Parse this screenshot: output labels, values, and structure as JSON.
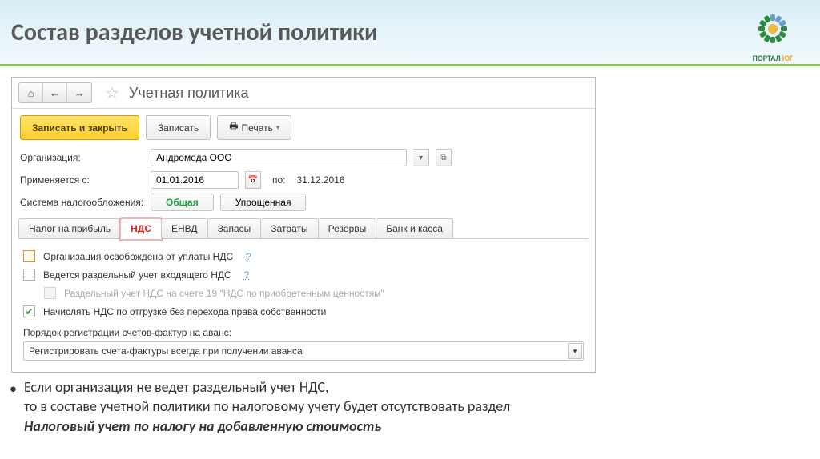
{
  "slide": {
    "title": "Состав разделов учетной политики",
    "logo": {
      "line1": "ПОРТАЛ",
      "line2": "ЮГ"
    }
  },
  "form": {
    "title": "Учетная политика",
    "toolbar": {
      "save_close": "Записать и закрыть",
      "save": "Записать",
      "print": "Печать"
    },
    "labels": {
      "organization": "Организация:",
      "applies_from": "Применяется с:",
      "to": "по:",
      "tax_system": "Система налогообложения:"
    },
    "values": {
      "organization": "Андромеда ООО",
      "date_from": "01.01.2016",
      "date_to": "31.12.2016"
    },
    "tax_system": {
      "general": "Общая",
      "simplified": "Упрощенная"
    },
    "tabs": {
      "profit_tax": "Налог на прибыль",
      "vat": "НДС",
      "envd": "ЕНВД",
      "stocks": "Запасы",
      "costs": "Затраты",
      "reserves": "Резервы",
      "bank_cash": "Банк и касса"
    },
    "vat_section": {
      "exempt": "Организация освобождена от уплаты НДС",
      "separate": "Ведется раздельный учет входящего НДС",
      "separate_sub": "Раздельный учет НДС на счете 19 \"НДС по приобретенным ценностям\"",
      "accrue": "Начислять НДС по отгрузке без перехода права собственности",
      "invoice_order_label": "Порядок регистрации счетов-фактур на аванс:",
      "invoice_order_value": "Регистрировать счета-фактуры всегда при получении аванса"
    }
  },
  "body_text": {
    "line1": "Если организация не ведет раздельный учет НДС,",
    "line2": "то в составе учетной политики по налоговому учету будет отсутствовать раздел",
    "line3_emph": "Налоговый учет по налогу на добавленную стоимость"
  }
}
